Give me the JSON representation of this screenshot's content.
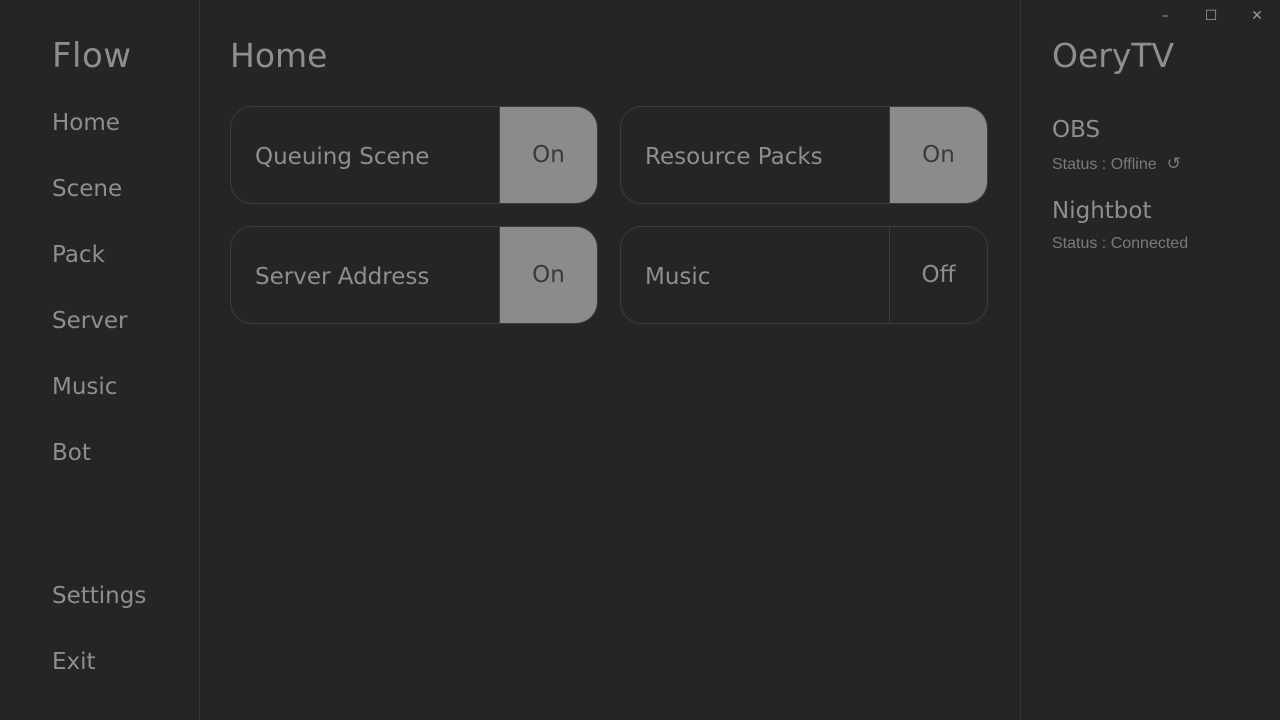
{
  "sidebar": {
    "brand": "Flow",
    "items": [
      {
        "label": "Home"
      },
      {
        "label": "Scene"
      },
      {
        "label": "Pack"
      },
      {
        "label": "Server"
      },
      {
        "label": "Music"
      },
      {
        "label": "Bot"
      }
    ],
    "bottom": [
      {
        "label": "Settings"
      },
      {
        "label": "Exit"
      }
    ]
  },
  "main": {
    "title": "Home",
    "cards": [
      {
        "label": "Queuing Scene",
        "state": "On"
      },
      {
        "label": "Resource Packs",
        "state": "On"
      },
      {
        "label": "Server Address",
        "state": "On"
      },
      {
        "label": "Music",
        "state": "Off"
      }
    ]
  },
  "right": {
    "user": "OeryTV",
    "services": [
      {
        "name": "OBS",
        "status": "Status : Offline",
        "refresh_icon": "↺"
      },
      {
        "name": "Nightbot",
        "status": "Status : Connected"
      }
    ]
  },
  "window": {
    "minimize": "–",
    "maximize": "☐",
    "close": "✕"
  }
}
